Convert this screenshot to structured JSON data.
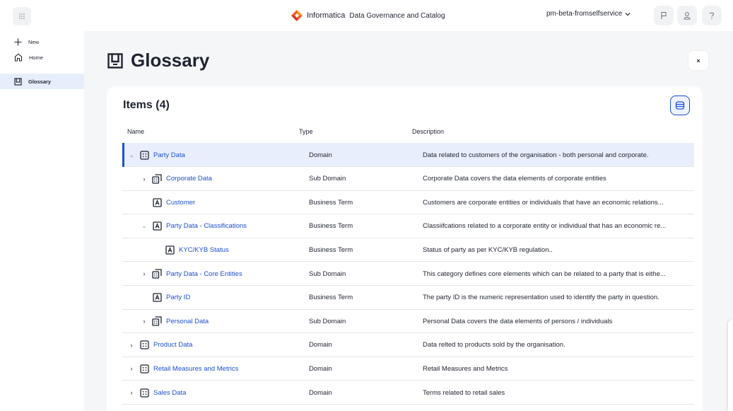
{
  "header": {
    "brand_name": "Informatica",
    "product_name": "Data Governance and Catalog",
    "org_name": "pm-beta-fromselfservice",
    "brand_color": "#f15a22",
    "icons": {
      "app_switcher": "grid-icon",
      "org_dropdown": "chevron-down-icon",
      "flag": "flag-icon",
      "user": "user-icon",
      "help": "help-icon"
    }
  },
  "nav": {
    "items": [
      {
        "label": "New",
        "icon": "plus-icon"
      },
      {
        "label": "Home",
        "icon": "home-icon"
      },
      {
        "label": "Glossary",
        "icon": "glossary-icon",
        "active": true
      }
    ]
  },
  "page": {
    "title": "Glossary",
    "close_label": "×"
  },
  "items": {
    "title": "Items (4)",
    "columns": [
      "Name",
      "Type",
      "Description"
    ],
    "accent_color": "#1d4fd0",
    "rows": [
      {
        "name": "Party Data",
        "type": "Domain",
        "description": "Data related to customers of the organisation - both personal and corporate.",
        "level": 0,
        "expander": "down",
        "icon": "domain-icon",
        "selected": true
      },
      {
        "name": "Corporate Data",
        "type": "Sub Domain",
        "description": "Corporate Data covers the data elements of corporate entities",
        "level": 1,
        "expander": "right",
        "icon": "subdomain-icon"
      },
      {
        "name": "Customer",
        "type": "Business Term",
        "description": "Customers are corporate entities or individuals that have an economic relations...",
        "level": 1,
        "expander": "none",
        "icon": "business-term-icon"
      },
      {
        "name": "Party Data - Classifications",
        "type": "Business Term",
        "description": "Classiifcations related to a corporate entity or individual that has an economic re...",
        "level": 1,
        "expander": "down",
        "icon": "business-term-icon"
      },
      {
        "name": "KYC/KYB Status",
        "type": "Business Term",
        "description": "Status of party as per KYC/KYB regulation..",
        "level": 2,
        "expander": "none",
        "icon": "business-term-icon"
      },
      {
        "name": "Party Data - Core Entities",
        "type": "Sub Domain",
        "description": "This category defines core elements which can be related to a party that is eithe...",
        "level": 1,
        "expander": "right",
        "icon": "subdomain-icon"
      },
      {
        "name": "Party ID",
        "type": "Business Term",
        "description": "The party ID is the numeric representation used to identify the party in question.",
        "level": 1,
        "expander": "none",
        "icon": "business-term-icon"
      },
      {
        "name": "Personal Data",
        "type": "Sub Domain",
        "description": "Personal Data covers the data elements of persons / individuals",
        "level": 1,
        "expander": "right",
        "icon": "subdomain-icon"
      },
      {
        "name": "Product Data",
        "type": "Domain",
        "description": "Data relted to products sold by the organisation.",
        "level": 0,
        "expander": "right",
        "icon": "domain-icon"
      },
      {
        "name": "Retail Measures and Metrics",
        "type": "Domain",
        "description": "Retail Measures and Metrics",
        "level": 0,
        "expander": "right",
        "icon": "domain-icon"
      },
      {
        "name": "Sales Data",
        "type": "Domain",
        "description": "Terms related to retail sales",
        "level": 0,
        "expander": "right",
        "icon": "domain-icon"
      }
    ]
  }
}
